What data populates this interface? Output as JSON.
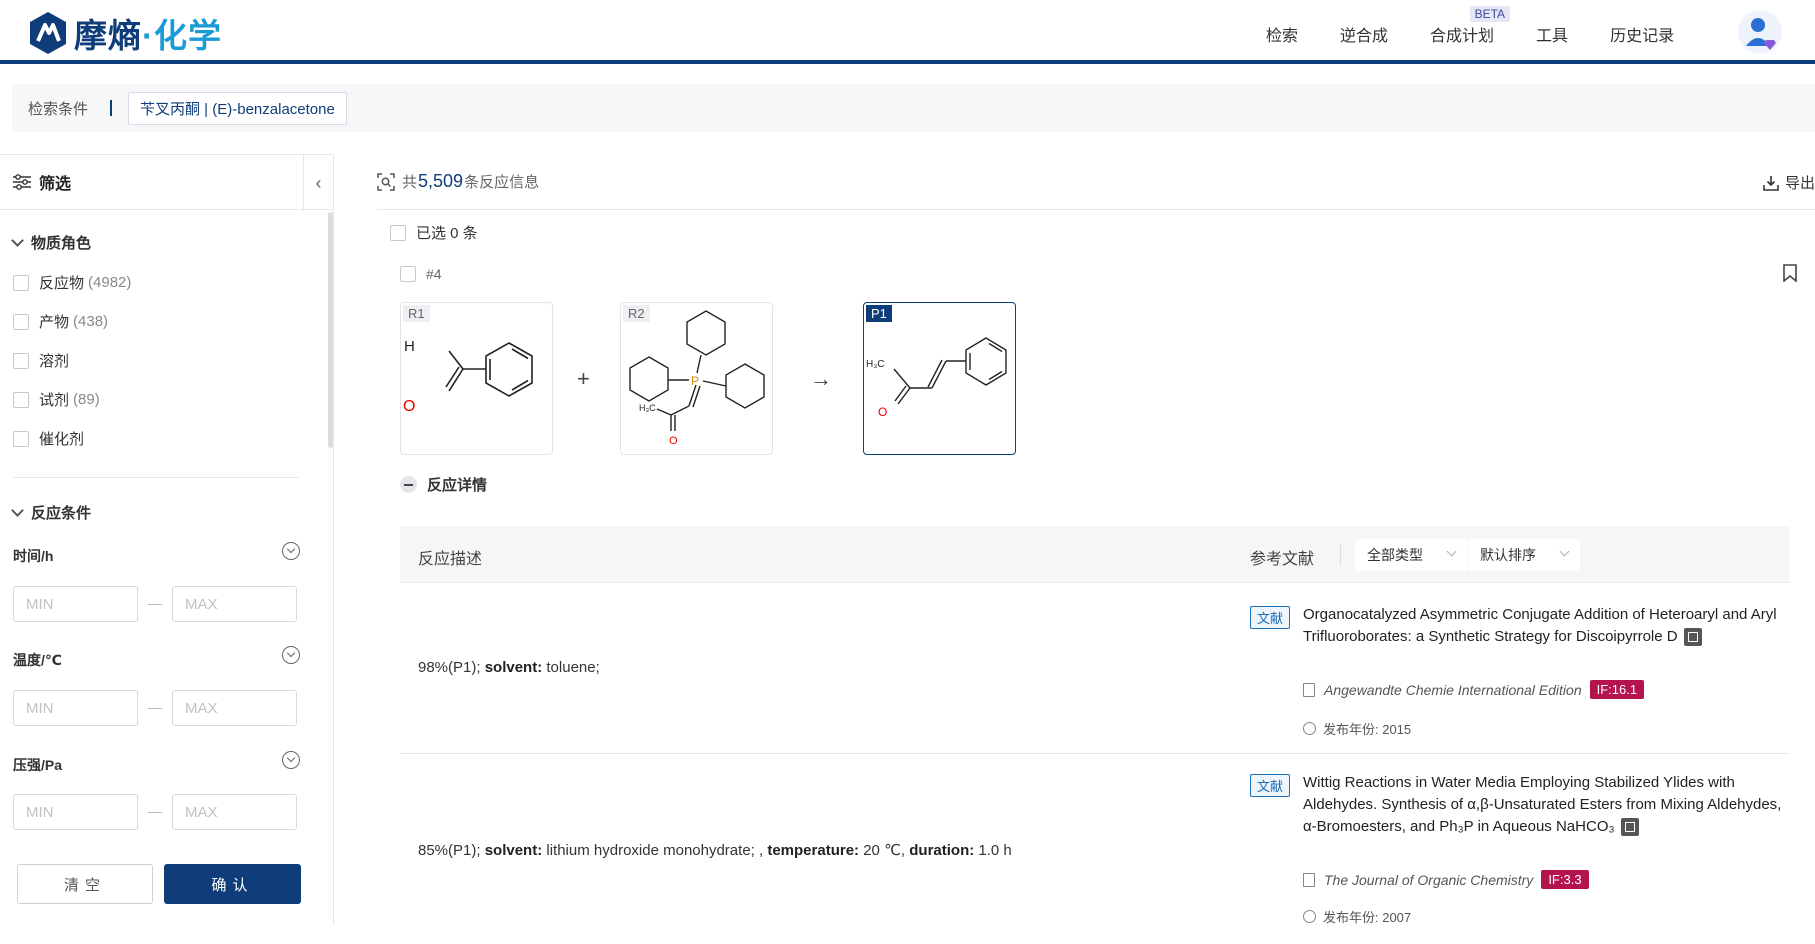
{
  "header": {
    "logo_text_main": "摩熵",
    "logo_text_accent": "·化学",
    "nav": [
      {
        "label": "检索"
      },
      {
        "label": "逆合成"
      },
      {
        "label": "合成计划",
        "badge": "BETA"
      },
      {
        "label": "工具"
      },
      {
        "label": "历史记录"
      }
    ]
  },
  "search": {
    "label": "检索条件",
    "tag": "苄叉丙酮 | (E)-benzalacetone"
  },
  "sidebar": {
    "title": "筛选",
    "role_section": "物质角色",
    "roles": [
      {
        "label": "反应物",
        "count": "(4982)"
      },
      {
        "label": "产物",
        "count": "(438)"
      },
      {
        "label": "溶剂",
        "count": ""
      },
      {
        "label": "试剂",
        "count": "(89)"
      },
      {
        "label": "催化剂",
        "count": ""
      }
    ],
    "cond_section": "反应条件",
    "conditions": [
      {
        "label": "时间/h"
      },
      {
        "label": "温度/℃"
      },
      {
        "label": "压强/Pa"
      }
    ],
    "min_placeholder": "MIN",
    "max_placeholder": "MAX",
    "clear": "清空",
    "confirm": "确认"
  },
  "results": {
    "prefix": "共",
    "count": "5,509",
    "suffix": "条反应信息",
    "export": "导出",
    "selected": "已选 0 条"
  },
  "reaction": {
    "id": "#4",
    "r1": "R1",
    "r2": "R2",
    "p1": "P1",
    "plus": "+",
    "arrow": "→",
    "detail_toggle": "反应详情",
    "col_desc": "反应描述",
    "col_ref": "参考文献",
    "filter_type": "全部类型",
    "filter_sort": "默认排序",
    "rows": [
      {
        "yield": "98%(P1); ",
        "k1": "solvent:",
        "v1": " toluene;",
        "tag": "文献",
        "title": "Organocatalyzed Asymmetric Conjugate Addition of Heteroaryl and Aryl Trifluoroborates: a Synthetic Strategy for Discoipyrrole D",
        "journal": "Angewandte Chemie International Edition",
        "if": "IF:16.1",
        "year": "发布年份: 2015"
      },
      {
        "yield": "85%(P1); ",
        "k1": "solvent:",
        "v1": " lithium hydroxide monohydrate; , ",
        "k2": "temperature:",
        "v2": " 20 ℃, ",
        "k3": "duration:",
        "v3": " 1.0 h",
        "tag": "文献",
        "title": "Wittig Reactions in Water Media Employing Stabilized Ylides with Aldehydes. Synthesis of α,β-Unsaturated Esters from Mixing Aldehydes, α-Bromoesters, and Ph₃P in Aqueous NaHCO₃",
        "journal": "The Journal of Organic Chemistry",
        "if": "IF:3.3",
        "year": "发布年份: 2007"
      }
    ]
  },
  "molecules": {
    "r1_atoms": {
      "h": "H",
      "o": "O"
    },
    "r2_atoms": {
      "p": "P",
      "me": "H₃C",
      "o": "O"
    },
    "p1_atoms": {
      "me": "H₃C",
      "o": "O"
    }
  },
  "colors": {
    "brand": "#0f3d7a",
    "accent": "#1a9ad6",
    "if_badge": "#b5134d"
  }
}
